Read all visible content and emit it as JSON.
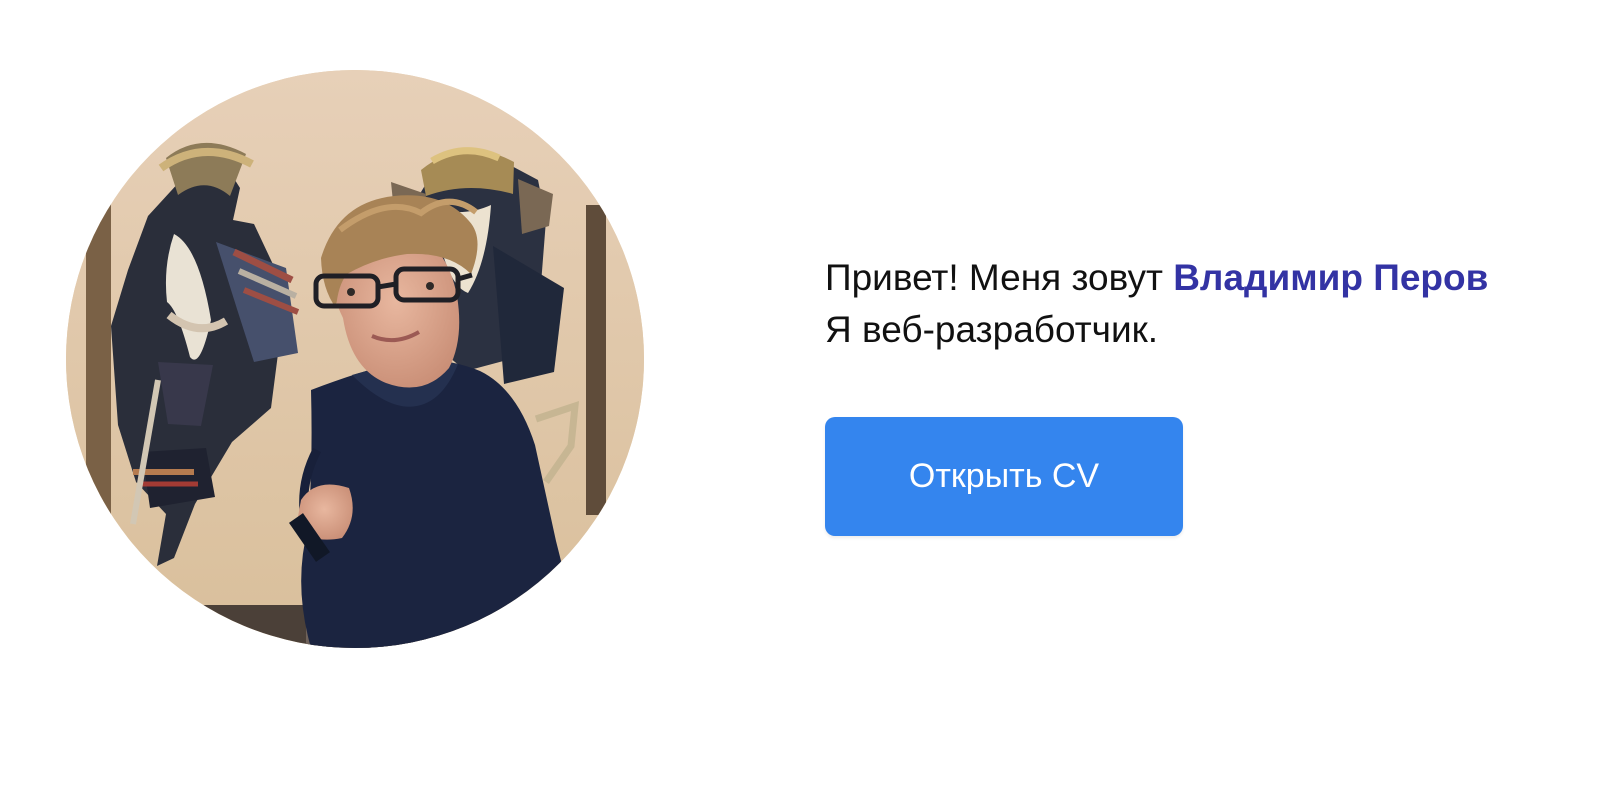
{
  "profile": {
    "photo_alt": "avatar photo"
  },
  "intro": {
    "greeting": "Привет! Меня зовут",
    "name": "Владимир Перов",
    "role": "Я веб-разработчик."
  },
  "actions": {
    "open_cv_label": "Открыть CV"
  },
  "colors": {
    "name_accent": "#3333a4",
    "button_background": "#3485ee",
    "button_text": "#ffffff"
  }
}
